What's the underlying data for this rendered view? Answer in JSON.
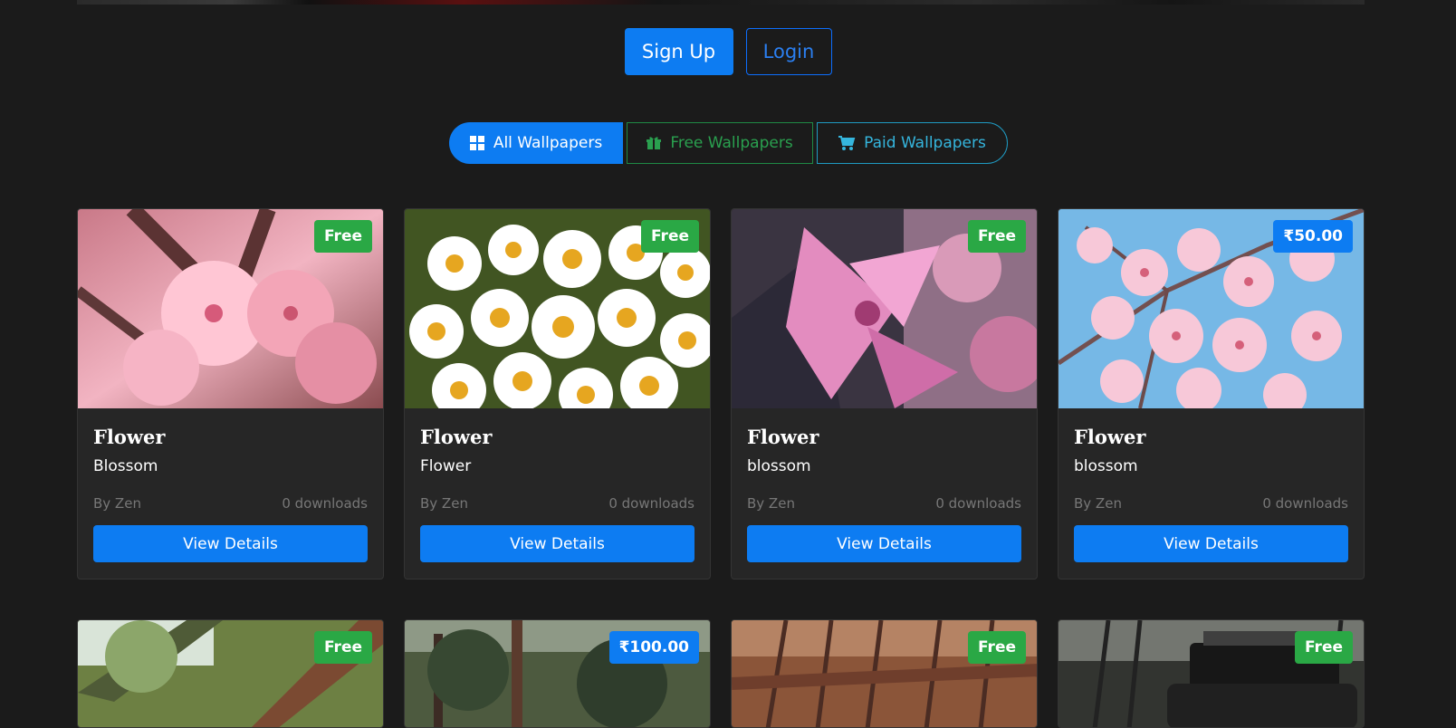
{
  "auth": {
    "signup_label": "Sign Up",
    "login_label": "Login"
  },
  "filters": [
    {
      "label": "All Wallpapers",
      "icon": "grid-icon",
      "active": true
    },
    {
      "label": "Free Wallpapers",
      "icon": "gift-icon",
      "active": false
    },
    {
      "label": "Paid Wallpapers",
      "icon": "cart-icon",
      "active": false
    }
  ],
  "cards": [
    {
      "badge": "Free",
      "badge_type": "free",
      "title": "Flower",
      "category": "Blossom",
      "author": "By Zen",
      "downloads": "0 downloads",
      "button": "View Details"
    },
    {
      "badge": "Free",
      "badge_type": "free",
      "title": "Flower",
      "category": "Flower",
      "author": "By Zen",
      "downloads": "0 downloads",
      "button": "View Details"
    },
    {
      "badge": "Free",
      "badge_type": "free",
      "title": "Flower",
      "category": "blossom",
      "author": "By Zen",
      "downloads": "0 downloads",
      "button": "View Details"
    },
    {
      "badge": "₹50.00",
      "badge_type": "paid",
      "title": "Flower",
      "category": "blossom",
      "author": "By Zen",
      "downloads": "0 downloads",
      "button": "View Details"
    },
    {
      "badge": "Free",
      "badge_type": "free"
    },
    {
      "badge": "₹100.00",
      "badge_type": "paid"
    },
    {
      "badge": "Free",
      "badge_type": "free"
    },
    {
      "badge": "Free",
      "badge_type": "free"
    }
  ],
  "colors": {
    "background": "#1b1b1b",
    "card": "#262626",
    "primary": "#0d7cf2",
    "success": "#2aa845",
    "info": "#35b6de"
  }
}
